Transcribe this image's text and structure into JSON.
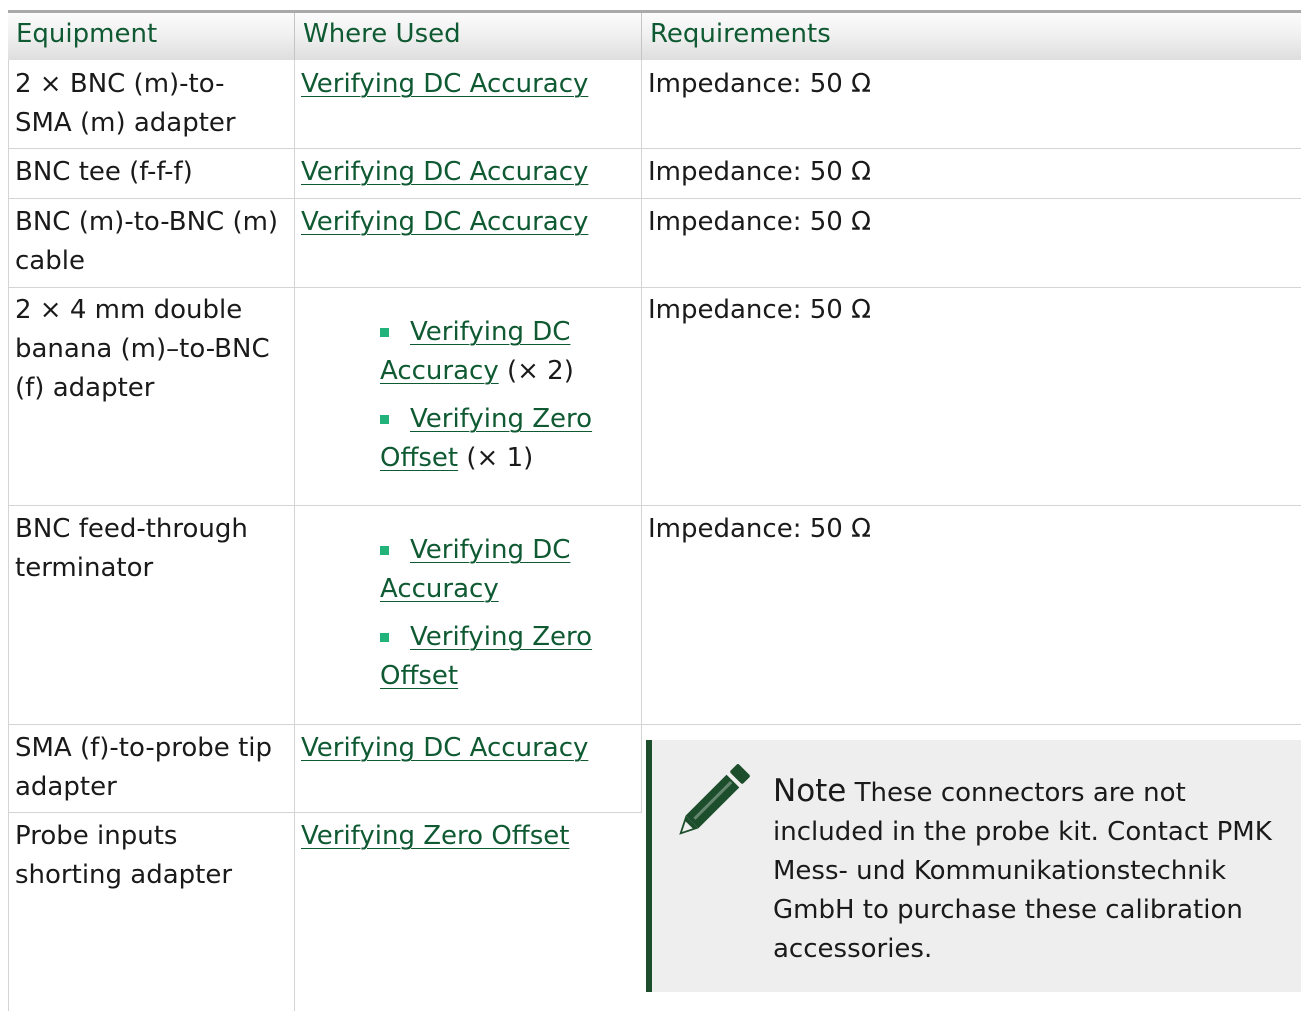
{
  "table": {
    "headers": [
      "Equipment",
      "Where Used",
      "Requirements"
    ],
    "rows": [
      {
        "equipment": "2 × BNC (m)-to-SMA (m) adapter",
        "where_used": "Verifying DC Accuracy",
        "requirements": "Impedance: 50 Ω"
      },
      {
        "equipment": "BNC tee (f-f-f)",
        "where_used": "Verifying DC Accuracy",
        "requirements": "Impedance: 50 Ω"
      },
      {
        "equipment": "BNC (m)-to-BNC (m) cable",
        "where_used": "Verifying DC Accuracy",
        "requirements": "Impedance: 50 Ω"
      },
      {
        "equipment": "2 × 4 mm double banana (m)–to-BNC (f) adapter",
        "where_used_list": [
          {
            "link": "Verifying DC Accuracy",
            "suffix": " (× 2)"
          },
          {
            "link": "Verifying Zero Offset",
            "suffix": " (× 1)"
          }
        ],
        "requirements": "Impedance: 50 Ω"
      },
      {
        "equipment": "BNC feed-through terminator",
        "where_used_list": [
          {
            "link": "Verifying DC Accuracy",
            "suffix": ""
          },
          {
            "link": "Verifying Zero Offset",
            "suffix": ""
          }
        ],
        "requirements": "Impedance: 50 Ω"
      },
      {
        "equipment": "SMA (f)-to-probe tip adapter",
        "where_used": "Verifying DC Accuracy"
      },
      {
        "equipment": "Probe inputs shorting adapter",
        "where_used": "Verifying Zero Offset"
      }
    ]
  },
  "note": {
    "icon": "pencil-icon",
    "label": "Note",
    "text": "These connectors are not included in the probe kit. Contact PMK Mess- und Kommunikationstechnik GmbH to purchase these calibration accessories."
  },
  "colors": {
    "header_text": "#0f5a32",
    "link": "#0f5a32",
    "bullet": "#21b37a",
    "note_bar": "#1d4e2c",
    "note_bg": "#eeeeee"
  }
}
